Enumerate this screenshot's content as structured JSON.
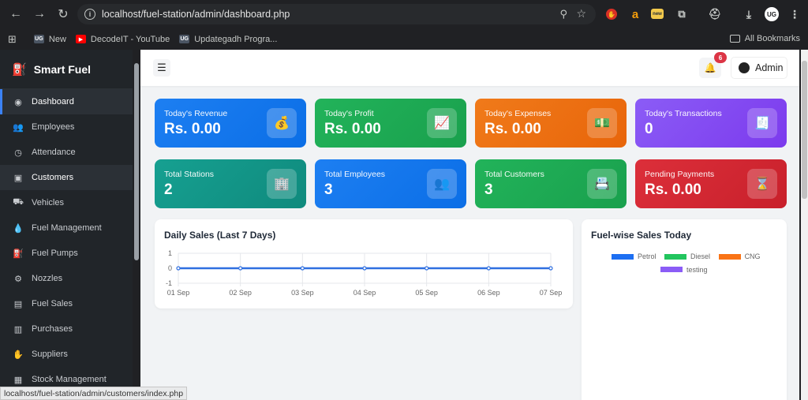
{
  "browser": {
    "url": "localhost/fuel-station/admin/dashboard.php",
    "bookmarks": [
      {
        "label": "New",
        "favicon": "UG",
        "color": "#4b5563"
      },
      {
        "label": "DecodeIT - YouTube",
        "favicon": "▶",
        "color": "#ff0000"
      },
      {
        "label": "Updategadh Progra...",
        "favicon": "UG",
        "color": "#4b5563"
      }
    ],
    "all_bookmarks": "All Bookmarks"
  },
  "sidebar": {
    "brand": "Smart Fuel",
    "items": [
      {
        "label": "Dashboard",
        "icon": "gauge-icon"
      },
      {
        "label": "Employees",
        "icon": "users-icon"
      },
      {
        "label": "Attendance",
        "icon": "clock-icon"
      },
      {
        "label": "Customers",
        "icon": "address-card-icon"
      },
      {
        "label": "Vehicles",
        "icon": "truck-icon"
      },
      {
        "label": "Fuel Management",
        "icon": "droplet-icon"
      },
      {
        "label": "Fuel Pumps",
        "icon": "gas-pump-icon"
      },
      {
        "label": "Nozzles",
        "icon": "nozzle-icon"
      },
      {
        "label": "Fuel Sales",
        "icon": "receipt-icon"
      },
      {
        "label": "Purchases",
        "icon": "dolly-icon"
      },
      {
        "label": "Suppliers",
        "icon": "handshake-icon"
      },
      {
        "label": "Stock Management",
        "icon": "boxes-icon"
      }
    ]
  },
  "topbar": {
    "notifications": "6",
    "user": "Admin"
  },
  "cards": [
    {
      "label": "Today's Revenue",
      "value": "Rs. 0.00",
      "icon": "money-bag-icon",
      "color": "#1d7ff2"
    },
    {
      "label": "Today's Profit",
      "value": "Rs. 0.00",
      "icon": "chart-line-icon",
      "color": "#22b35a"
    },
    {
      "label": "Today's Expenses",
      "value": "Rs. 0.00",
      "icon": "money-bill-icon",
      "color": "#f07a1a"
    },
    {
      "label": "Today's Transactions",
      "value": "0",
      "icon": "receipt-icon",
      "color": "#8b5cf6"
    },
    {
      "label": "Total Stations",
      "value": "2",
      "icon": "building-icon",
      "color": "#16a091"
    },
    {
      "label": "Total Employees",
      "value": "3",
      "icon": "users-icon",
      "color": "#1d7ff2"
    },
    {
      "label": "Total Customers",
      "value": "3",
      "icon": "address-book-icon",
      "color": "#22b35a"
    },
    {
      "label": "Pending Payments",
      "value": "Rs. 0.00",
      "icon": "hourglass-icon",
      "color": "#dc2f3a"
    }
  ],
  "daily_sales": {
    "title": "Daily Sales (Last 7 Days)"
  },
  "fuel_sales": {
    "title": "Fuel-wise Sales Today",
    "legend": [
      {
        "name": "Petrol",
        "color": "#1d6ff2"
      },
      {
        "name": "Diesel",
        "color": "#22c55e"
      },
      {
        "name": "CNG",
        "color": "#f97316"
      },
      {
        "name": "testing",
        "color": "#8b5cf6"
      }
    ]
  },
  "chart_data": {
    "type": "line",
    "title": "Daily Sales (Last 7 Days)",
    "categories": [
      "01 Sep",
      "02 Sep",
      "03 Sep",
      "04 Sep",
      "05 Sep",
      "06 Sep",
      "07 Sep"
    ],
    "values": [
      0,
      0,
      0,
      0,
      0,
      0,
      0
    ],
    "y_ticks": [
      "1",
      "0",
      "-1"
    ],
    "ylim": [
      -1,
      1
    ],
    "grid": true,
    "line_color": "#2f6fe0"
  },
  "status_url": "localhost/fuel-station/admin/customers/index.php"
}
